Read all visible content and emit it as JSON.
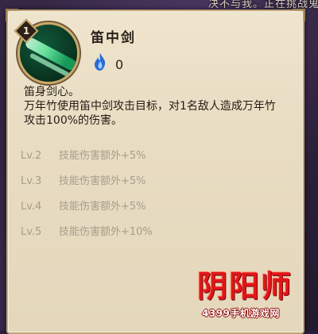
{
  "top_banner": "决不与我。正在挑战鬼使黑",
  "skill": {
    "level": "1",
    "name": "笛中剑",
    "cost": "0"
  },
  "description": {
    "line1": "笛身剑心。",
    "line2": "万年竹使用笛中剑攻击目标，对1名敌人造成万年竹攻击100%的伤害。"
  },
  "levels": [
    {
      "lv": "Lv.2",
      "effect": "技能伤害额外+5%"
    },
    {
      "lv": "Lv.3",
      "effect": "技能伤害额外+5%"
    },
    {
      "lv": "Lv.4",
      "effect": "技能伤害额外+5%"
    },
    {
      "lv": "Lv.5",
      "effect": "技能伤害额外+10%"
    }
  ],
  "watermark": {
    "title": "阴阳师",
    "site": "4399手机游戏网"
  },
  "icons": {
    "skill": "sword-flute-icon",
    "cost": "blue-fire-icon"
  },
  "colors": {
    "panel": "#e8dcc2",
    "text": "#231c15",
    "muted": "#a89d8c",
    "watermark": "#e2161a"
  }
}
